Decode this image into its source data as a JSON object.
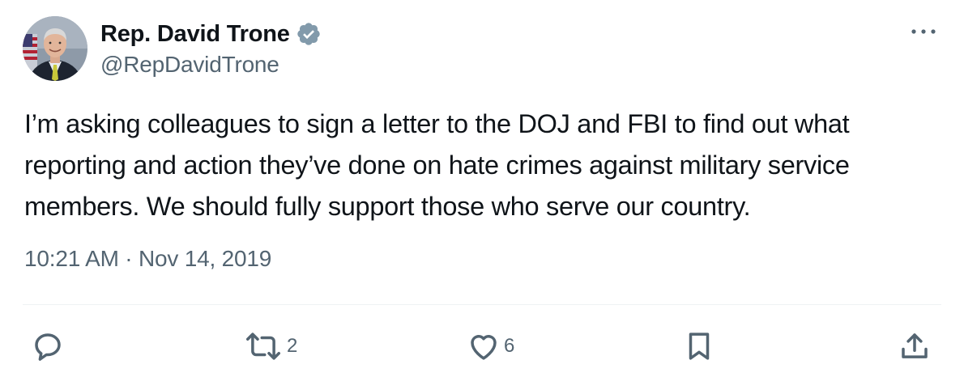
{
  "author": {
    "display_name": "Rep. David Trone",
    "handle": "@RepDavidTrone",
    "verified": true,
    "avatar_icon": "profile-photo"
  },
  "tweet": {
    "text_lines": [
      "I’m asking colleagues to sign a letter to the DOJ and FBI to find out what",
      "reporting and action they’ve done on hate crimes against military service",
      "members. We should fully support those who serve our country."
    ],
    "timestamp": "10:21 AM · Nov 14, 2019"
  },
  "actions": {
    "reply": {
      "icon": "reply-icon",
      "count": ""
    },
    "retweet": {
      "icon": "retweet-icon",
      "count": "2"
    },
    "like": {
      "icon": "heart-icon",
      "count": "6"
    },
    "bookmark": {
      "icon": "bookmark-icon"
    },
    "share": {
      "icon": "share-icon"
    }
  },
  "colors": {
    "text": "#0f1419",
    "secondary": "#536471",
    "verified_badge": "#829aab",
    "divider": "#eff3f4"
  }
}
